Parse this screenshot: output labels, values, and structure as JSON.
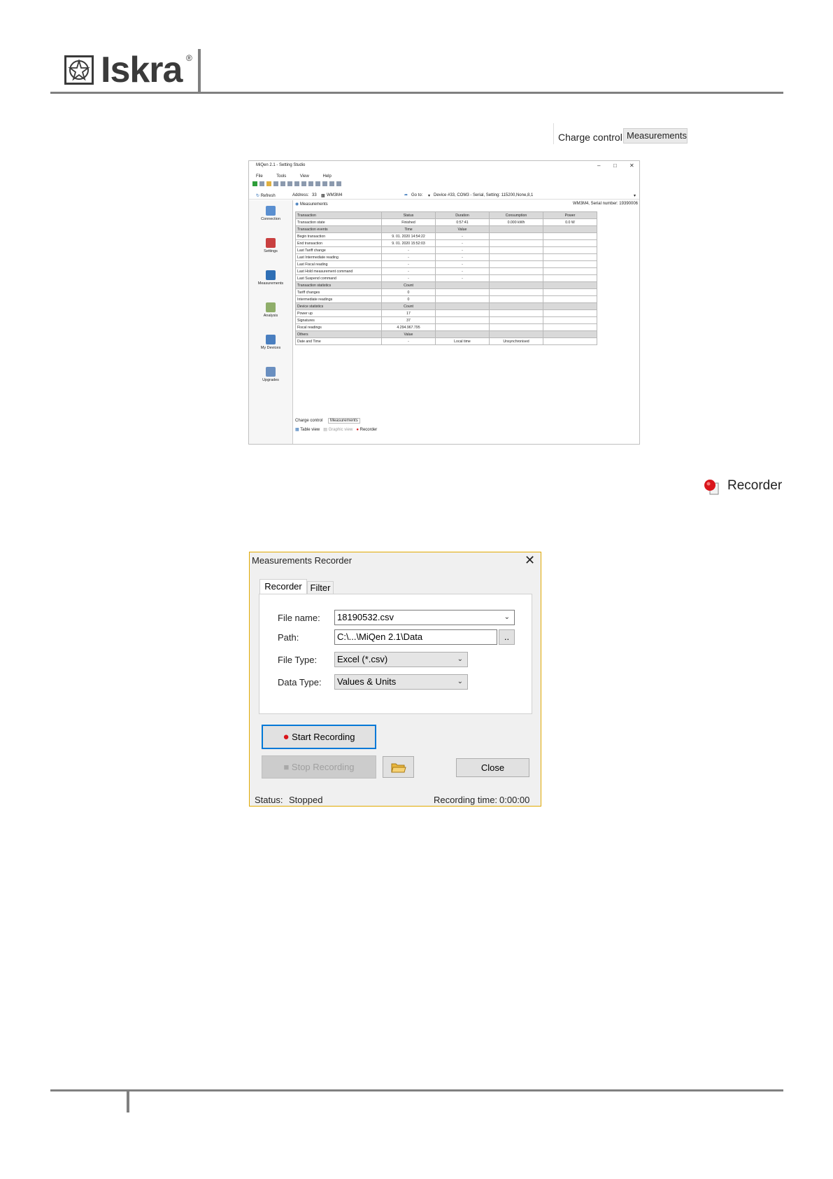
{
  "brand": {
    "name": "Iskra",
    "registered": "®"
  },
  "tabs_inset": {
    "charge_control": "Charge control",
    "measurements": "Measurements"
  },
  "recorder_inset": {
    "label": "Recorder"
  },
  "app": {
    "title": "MiQen 2.1 - Setting Studio",
    "menu": [
      "File",
      "Tools",
      "View",
      "Help"
    ],
    "refresh": "Refresh",
    "address_label": "Address:",
    "address_value": "33",
    "device_name": "WM3M4",
    "goto": "Go to:",
    "device_info": "Device #33, COM3 - Serial, Setting: 115200,None,8,1",
    "sidebar": [
      "Connection",
      "Settings",
      "Measurements",
      "Analysis",
      "My Devices",
      "Upgrades"
    ],
    "panel_title": "Measurements",
    "serial": "WM3M4, Serial number: 19390006",
    "table": [
      {
        "sec": true,
        "cells": [
          "Transaction",
          "Status",
          "Duration",
          "Consumption",
          "Power"
        ]
      },
      {
        "sec": false,
        "cells": [
          "Transaction state",
          "Finished",
          "0:57:41",
          "0.000 kWh",
          "0.0 W"
        ]
      },
      {
        "sec": true,
        "cells": [
          "Transaction events",
          "Time",
          "Value",
          "",
          ""
        ]
      },
      {
        "sec": false,
        "cells": [
          "Begin transaction",
          "9. 01. 2020 14:54:22",
          "-",
          "",
          ""
        ]
      },
      {
        "sec": false,
        "cells": [
          "End transaction",
          "9. 01. 2020 15:52:03",
          "-",
          "",
          ""
        ]
      },
      {
        "sec": false,
        "cells": [
          "Last Tariff change",
          "-",
          "-",
          "",
          ""
        ]
      },
      {
        "sec": false,
        "cells": [
          "Last Intermediate reading",
          "-",
          "-",
          "",
          ""
        ]
      },
      {
        "sec": false,
        "cells": [
          "Last Fiscal reading",
          "-",
          "-",
          "",
          ""
        ]
      },
      {
        "sec": false,
        "cells": [
          "Last Hold measurement command",
          "-",
          "-",
          "",
          ""
        ]
      },
      {
        "sec": false,
        "cells": [
          "Last Suspend command",
          "-",
          "-",
          "",
          ""
        ]
      },
      {
        "sec": true,
        "cells": [
          "Transaction statistics",
          "Count",
          "",
          "",
          ""
        ]
      },
      {
        "sec": false,
        "cells": [
          "Tariff changes",
          "0",
          "",
          "",
          ""
        ]
      },
      {
        "sec": false,
        "cells": [
          "Intermediate readings",
          "0",
          "",
          "",
          ""
        ]
      },
      {
        "sec": true,
        "cells": [
          "Device statistics",
          "Count",
          "",
          "",
          ""
        ]
      },
      {
        "sec": false,
        "cells": [
          "Power up",
          "17",
          "",
          "",
          ""
        ]
      },
      {
        "sec": false,
        "cells": [
          "Signatures",
          "37",
          "",
          "",
          ""
        ]
      },
      {
        "sec": false,
        "cells": [
          "Fiscal readings",
          "4.294.967.795",
          "",
          "",
          ""
        ]
      },
      {
        "sec": true,
        "cells": [
          "Others",
          "Value",
          "",
          "",
          ""
        ]
      },
      {
        "sec": false,
        "cells": [
          "Date and Time",
          "-",
          "Local time",
          "Unsynchronised",
          ""
        ]
      }
    ],
    "bottom_tabs": [
      "Charge control",
      "Measurements"
    ],
    "bottom_bar": [
      "Table view",
      "Graphic view",
      "Recorder"
    ]
  },
  "dialog": {
    "title": "Measurements Recorder",
    "tab_recorder": "Recorder",
    "tab_filter": "Filter",
    "file_name_label": "File name:",
    "file_name_value": "18190532.csv",
    "path_label": "Path:",
    "path_value": "C:\\...\\MiQen 2.1\\Data",
    "browse": "..",
    "file_type_label": "File Type:",
    "file_type_value": "Excel (*.csv)",
    "data_type_label": "Data Type:",
    "data_type_value": "Values & Units",
    "start": "Start Recording",
    "stop": "Stop Recording",
    "close": "Close",
    "status_label": "Status:",
    "status_value": "Stopped",
    "rec_time_label": "Recording time:",
    "rec_time_value": "0:00:00"
  },
  "colors": {
    "accent_border": "#e1a900",
    "focus_blue": "#0078d7",
    "record_red": "#d9151b",
    "header_gray": "#808080"
  }
}
